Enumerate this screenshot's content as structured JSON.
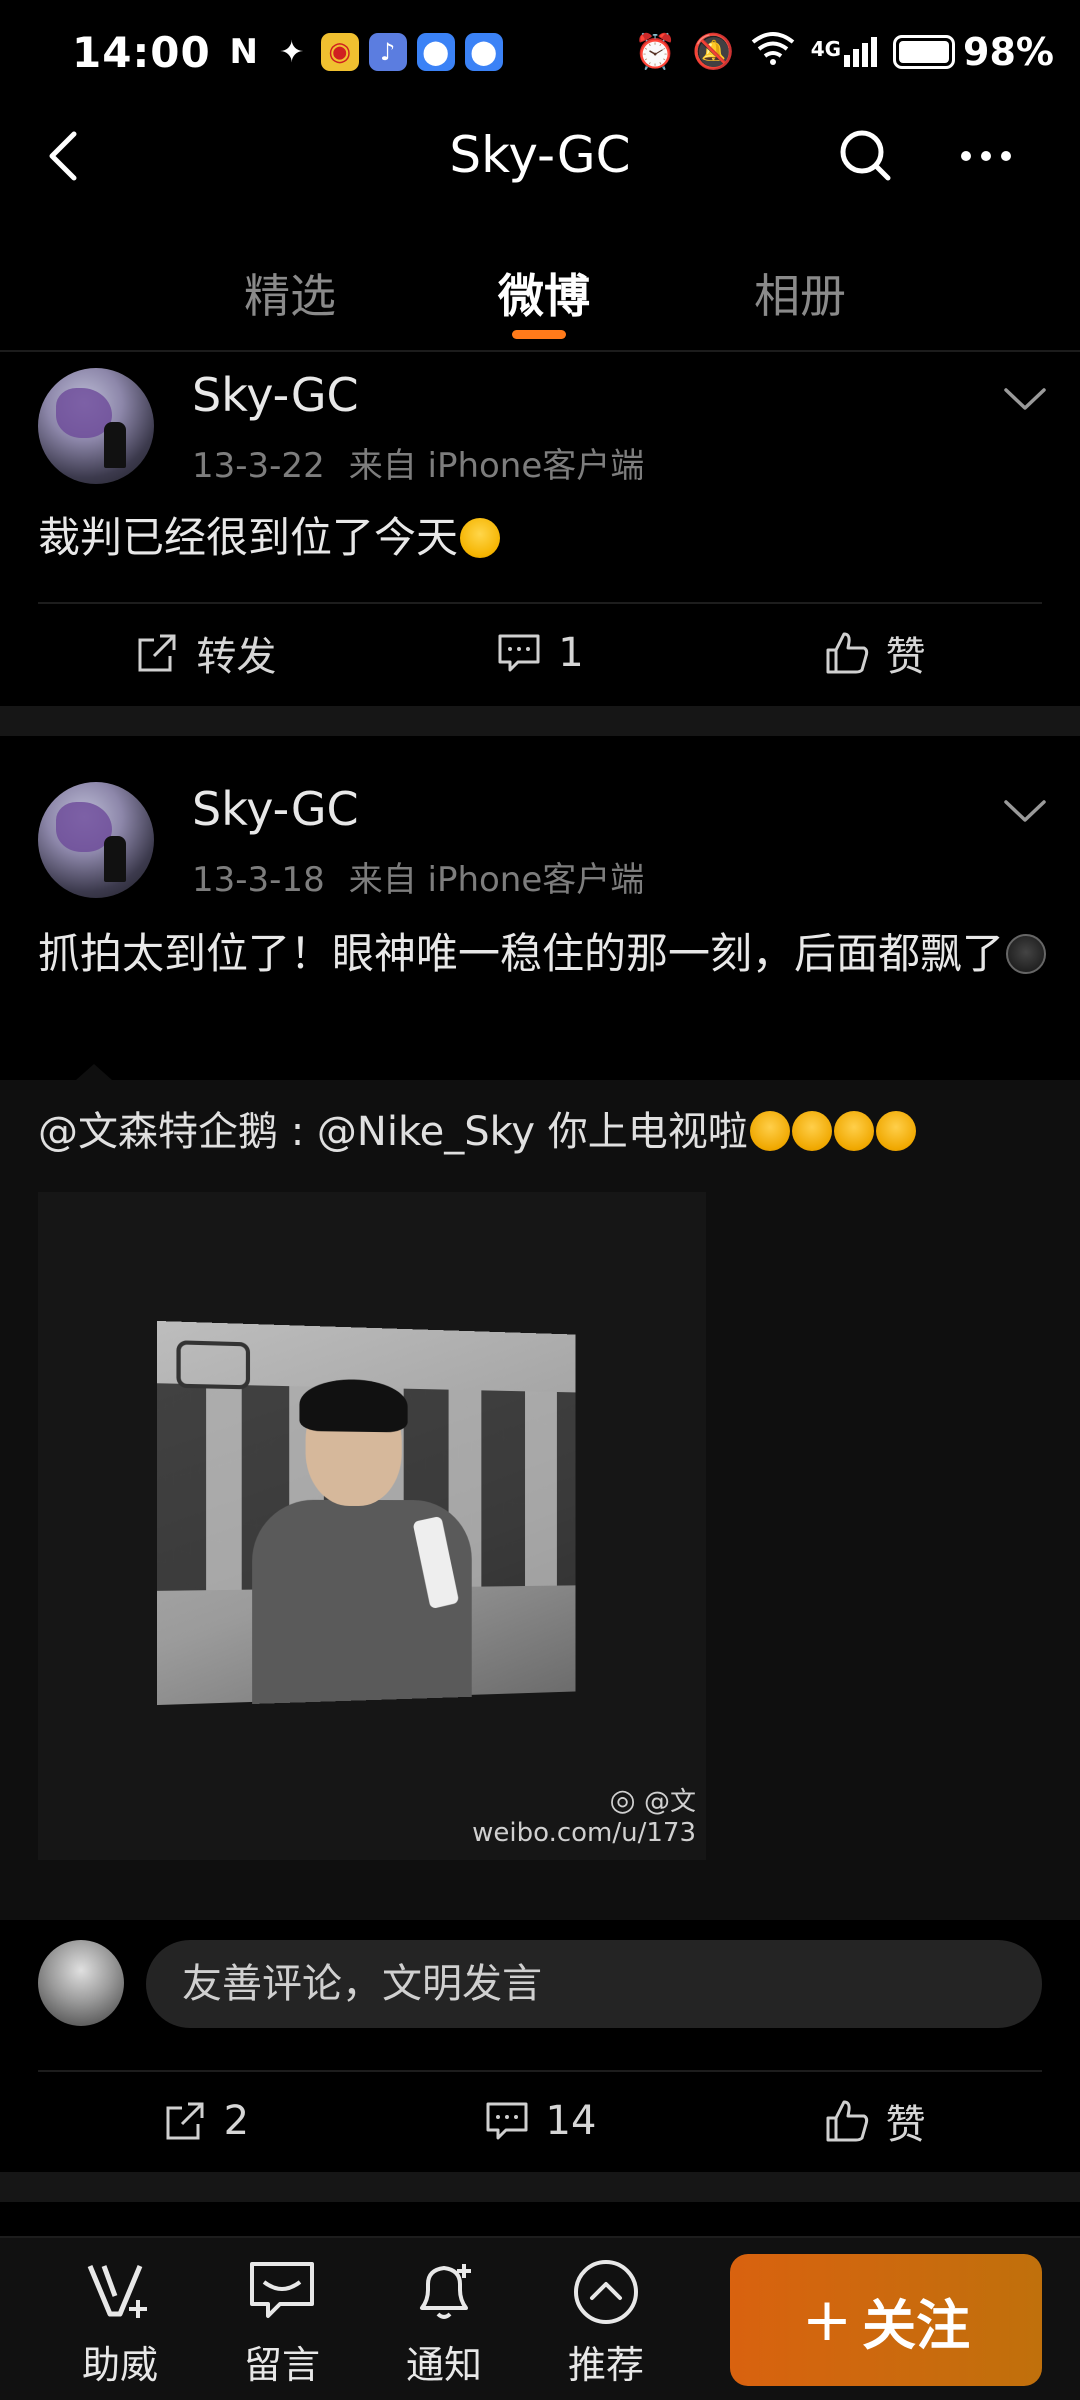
{
  "status_bar": {
    "time": "14:00",
    "network": "4G",
    "battery": "98%",
    "app_icons": [
      "nfc-icon",
      "wechat-icon",
      "weibo-icon",
      "music-icon",
      "app-icon",
      "app-icon"
    ]
  },
  "header": {
    "title": "Sky-GC"
  },
  "tabs": [
    {
      "label": "精选",
      "active": false
    },
    {
      "label": "微博",
      "active": true
    },
    {
      "label": "相册",
      "active": false
    }
  ],
  "posts": [
    {
      "username": "Sky-GC",
      "date": "13-3-22",
      "source": "来自 iPhone客户端",
      "text": "裁判已经很到位了今天",
      "actions": {
        "repost": "转发",
        "comment": "1",
        "like": "赞"
      }
    },
    {
      "username": "Sky-GC",
      "date": "13-3-18",
      "source": "来自 iPhone客户端",
      "text": "抓拍太到位了！眼神唯一稳住的那一刻，后面都飘了",
      "repost": {
        "text": "@文森特企鹅 : @Nike_Sky 你上电视啦",
        "watermark_line1": "@文",
        "watermark_line2": "weibo.com/u/173"
      },
      "comment_placeholder": "友善评论，文明发言",
      "actions": {
        "repost": "2",
        "comment": "14",
        "like": "赞"
      }
    }
  ],
  "bottom_nav": [
    {
      "label": "助威",
      "icon": "v-plus-icon"
    },
    {
      "label": "留言",
      "icon": "message-icon"
    },
    {
      "label": "通知",
      "icon": "bell-plus-icon"
    },
    {
      "label": "推荐",
      "icon": "chevron-up-circle-icon"
    }
  ],
  "follow_button": {
    "label": "关注",
    "prefix": "+"
  },
  "colors": {
    "accent": "#ff7a1a",
    "follow_gradient_start": "#d9620f",
    "follow_gradient_end": "#c0700c",
    "background": "#000000"
  }
}
